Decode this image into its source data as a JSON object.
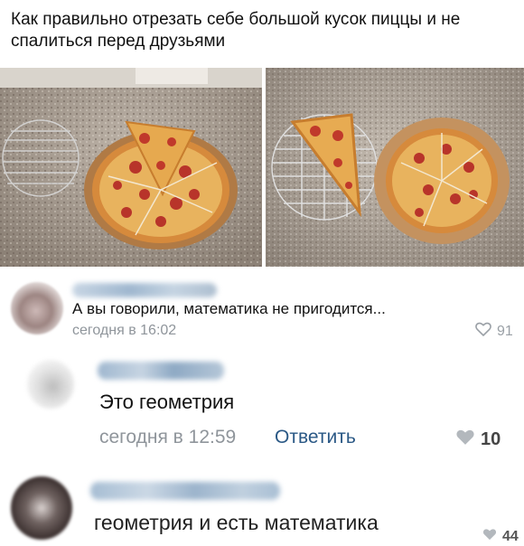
{
  "post": {
    "title": "Как правильно отрезать себе большой кусок пиццы и не спалиться перед друзьями"
  },
  "comments": [
    {
      "text": "А вы говорили, математика не пригодится...",
      "time": "сегодня в 16:02",
      "likes": "91",
      "like_icon": "heart-outline-icon"
    },
    {
      "text": "Это геометрия",
      "time": "сегодня в 12:59",
      "reply_label": "Ответить",
      "likes": "10",
      "like_icon": "heart-filled-icon"
    },
    {
      "text": "геометрия и есть математика",
      "likes": "44",
      "like_icon": "heart-filled-icon"
    }
  ],
  "colors": {
    "link": "#2a5885",
    "meta": "#8f959b",
    "name_blur": "#9fb7cf"
  }
}
